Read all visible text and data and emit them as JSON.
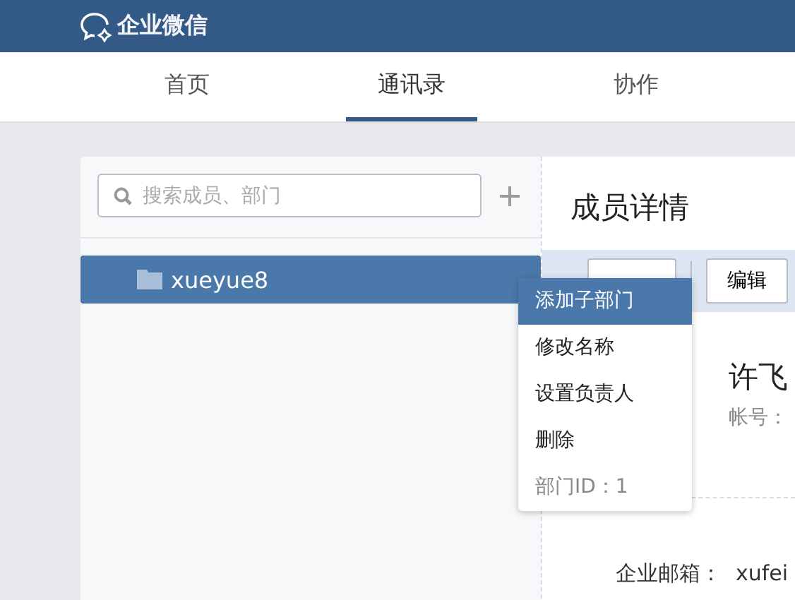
{
  "header": {
    "logo_text": "企业微信"
  },
  "tabs": [
    {
      "label": "首页",
      "selected": false
    },
    {
      "label": "通讯录",
      "selected": true
    },
    {
      "label": "协作",
      "selected": false
    }
  ],
  "sidebar": {
    "search": {
      "placeholder": "搜索成员、部门"
    },
    "departments": [
      {
        "name": "xueyue8",
        "selected": true
      }
    ]
  },
  "context_menu": {
    "items": [
      {
        "label": "添加子部门",
        "selected": true,
        "kind": "action"
      },
      {
        "label": "修改名称",
        "selected": false,
        "kind": "action"
      },
      {
        "label": "设置负责人",
        "selected": false,
        "kind": "action"
      },
      {
        "label": "删除",
        "selected": false,
        "kind": "action"
      },
      {
        "label": "部门ID：1",
        "selected": false,
        "kind": "info"
      }
    ]
  },
  "detail": {
    "title": "成员详情",
    "buttons": [
      "编辑"
    ],
    "name": "许飞",
    "account_label": "帐号：",
    "email_label": "企业邮箱：",
    "email_value": "xufei"
  }
}
